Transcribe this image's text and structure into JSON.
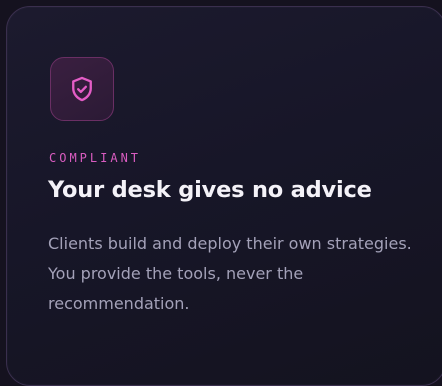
{
  "card": {
    "icon": "shield-check-icon",
    "eyebrow": "COMPLIANT",
    "title": "Your desk gives no advice",
    "description": "Clients build and deploy their own strategies. You provide the tools, never the recommendation."
  },
  "colors": {
    "accent": "#d95cc0",
    "background": "#15121f",
    "title": "#f4f2f8",
    "body": "#a3a1b8"
  }
}
